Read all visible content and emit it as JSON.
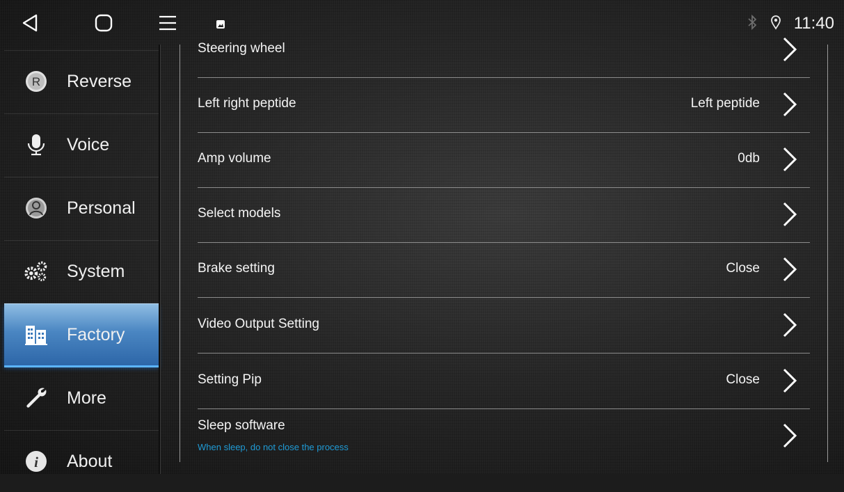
{
  "status_bar": {
    "nav": {
      "back_icon": "back-triangle-icon",
      "home_icon": "home-square-icon",
      "menu_icon": "hamburger-menu-icon"
    },
    "notification_icon": "image-notification-icon",
    "bluetooth_icon": "bluetooth-icon",
    "location_icon": "location-pin-icon",
    "time": "11:40"
  },
  "sidebar": {
    "items": [
      {
        "label": "Reverse",
        "icon": "reverse-r-icon"
      },
      {
        "label": "Voice",
        "icon": "microphone-icon"
      },
      {
        "label": "Personal",
        "icon": "person-icon"
      },
      {
        "label": "System",
        "icon": "gears-icon"
      },
      {
        "label": "Factory",
        "icon": "factory-icon",
        "active": true
      },
      {
        "label": "More",
        "icon": "wrench-icon"
      },
      {
        "label": "About",
        "icon": "info-icon"
      }
    ],
    "active_color": "#3a79bb"
  },
  "settings": {
    "rows": [
      {
        "title": "Steering wheel",
        "value": ""
      },
      {
        "title": "Left right peptide",
        "value": "Left peptide"
      },
      {
        "title": "Amp volume",
        "value": "0db"
      },
      {
        "title": "Select models",
        "value": ""
      },
      {
        "title": "Brake setting",
        "value": "Close"
      },
      {
        "title": "Video Output Setting",
        "value": ""
      },
      {
        "title": "Setting Pip",
        "value": "Close"
      },
      {
        "title": "Sleep software",
        "value": "",
        "subtitle": "When sleep, do not close the process"
      }
    ],
    "subtitle_color": "#1f9bd6"
  }
}
